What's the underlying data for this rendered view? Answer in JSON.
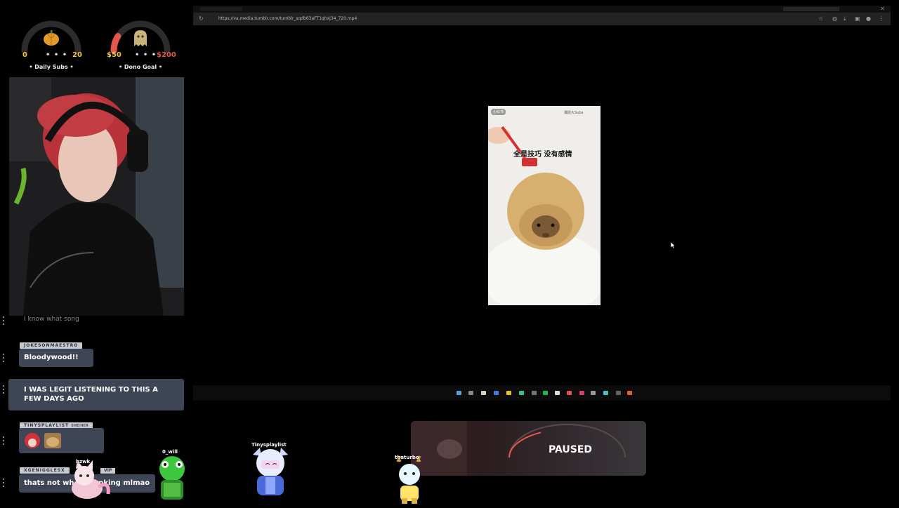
{
  "gauges": {
    "daily_subs": {
      "min": "0",
      "dots": "• • •",
      "max": "20",
      "title": "• Daily Subs •",
      "progress": 0.0
    },
    "dono_goal": {
      "min": "$50",
      "dots": "• • •",
      "max": "$200",
      "title": "• Dono Goal •",
      "progress": 0.18
    }
  },
  "chat": {
    "faded_message": "I know what song",
    "messages": [
      {
        "user": "JOKESONMAESTRO",
        "pronouns": "",
        "text": "Bloodywood!!"
      },
      {
        "user": "",
        "pronouns": "",
        "text": "I WAS LEGIT LISTENING TO THIS A FEW DAYS AGO"
      },
      {
        "user": "TINYSPLAYLIST",
        "pronouns": "SHE/HER",
        "text": ""
      },
      {
        "user": "XGENIGGLESX",
        "pronouns": "",
        "badge": "VIP",
        "text": "thats not wh          nking mlmao"
      }
    ]
  },
  "browser": {
    "url": "https://va.media.tumblr.com/tumblr_sqdb63aFT1qhxj34_720.mp4",
    "video": {
      "overlay_caption": "全是技巧  没有感情",
      "corner_badge": "小红书",
      "corner_tag": "捕捉大Suba"
    }
  },
  "paused_widget": {
    "label": "PAUSED",
    "progress": 0.35
  },
  "avatars": [
    {
      "name": "bzwk",
      "color": "#ff9fc9"
    },
    {
      "name": "0_will",
      "color": "#7dff4f"
    },
    {
      "name": "Tinysplaylist",
      "color": "#5fa0ff"
    },
    {
      "name": "thaturbo",
      "color": "#ffb23a"
    }
  ],
  "colors": {
    "accent_red": "#e5574c",
    "gauge_track": "#2c2c2c",
    "chat_bubble": "#3e4554"
  }
}
